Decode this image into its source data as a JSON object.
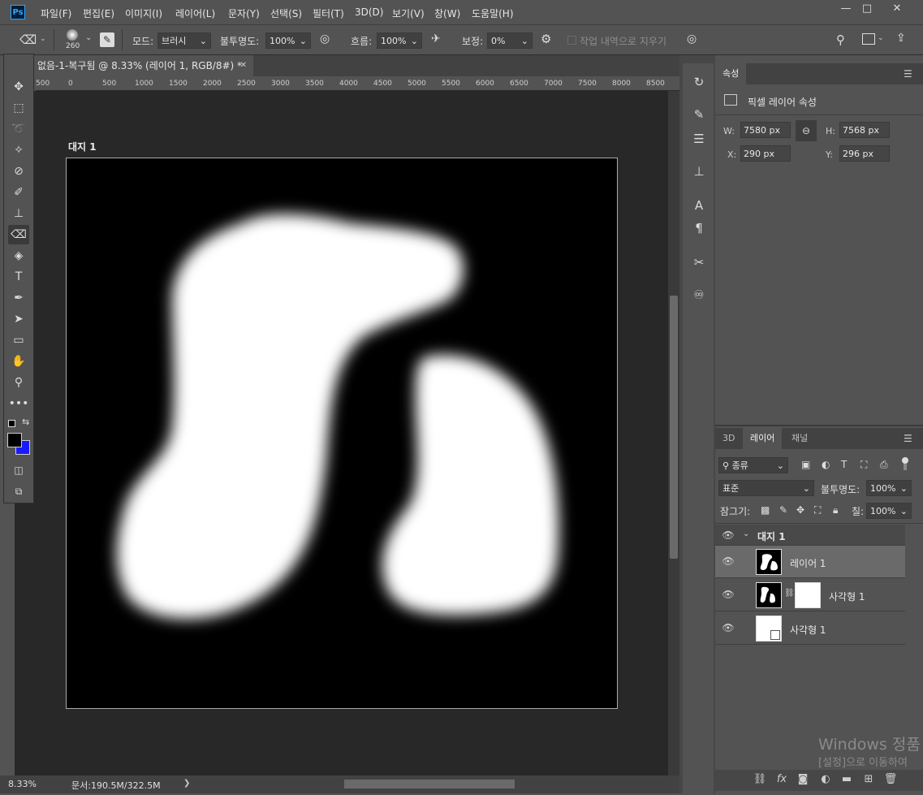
{
  "app": {
    "logo": "Ps"
  },
  "menu": [
    "파일(F)",
    "편집(E)",
    "이미지(I)",
    "레이어(L)",
    "문자(Y)",
    "선택(S)",
    "필터(T)",
    "3D(D)",
    "보기(V)",
    "창(W)",
    "도움말(H)"
  ],
  "window_controls": {
    "minimize": "—",
    "maximize": "□",
    "close": "✕"
  },
  "options": {
    "brush_size": "260",
    "mode_label": "모드:",
    "mode_value": "브러시",
    "opacity_label": "불투명도:",
    "opacity_value": "100%",
    "flow_label": "흐름:",
    "flow_value": "100%",
    "smoothing_label": "보정:",
    "smoothing_value": "0%",
    "erase_history_label": "작업 내역으로 지우기"
  },
  "document": {
    "tab_title": "없음-1-복구됨 @ 8.33% (레이어 1, RGB/8#) *",
    "close": "✕",
    "artboard_label": "대지 1"
  },
  "ruler_top": [
    "500",
    "0",
    "500",
    "1000",
    "1500",
    "2000",
    "2500",
    "3000",
    "3500",
    "4000",
    "4500",
    "5000",
    "5500",
    "6000",
    "6500",
    "7000",
    "7500",
    "8000",
    "8500"
  ],
  "status": {
    "zoom": "8.33%",
    "doc_size": "문서:190.5M/322.5M",
    "arrow": "❯"
  },
  "properties": {
    "panel_tab": "속성",
    "type_label": "픽셀 레이어 속성",
    "w_label": "W:",
    "w_value": "7580 px",
    "h_label": "H:",
    "h_value": "7568 px",
    "x_label": "X:",
    "x_value": "290 px",
    "y_label": "Y:",
    "y_value": "296 px"
  },
  "layers_panel": {
    "tabs": [
      "3D",
      "레이어",
      "채널"
    ],
    "filter_value": "종류",
    "blend_mode": "표준",
    "opacity_label": "불투명도:",
    "opacity_value": "100%",
    "lock_label": "잠그기:",
    "fill_label": "칠:",
    "fill_value": "100%",
    "group_name": "대지 1",
    "layers": [
      {
        "name": "레이어 1"
      },
      {
        "name": "사각형 1"
      },
      {
        "name": "사각형 1"
      }
    ]
  },
  "watermark": {
    "line1": "Windows 정품",
    "line2": "[설정]으로 이동하여"
  },
  "colors": {
    "foreground": "#000000",
    "background": "#1a1aff"
  }
}
